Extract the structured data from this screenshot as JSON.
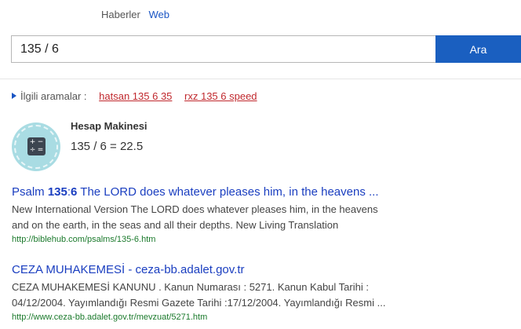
{
  "tabs": {
    "news": "Haberler",
    "web": "Web"
  },
  "search": {
    "query": "135 / 6",
    "button": "Ara"
  },
  "related": {
    "label": "İlgili aramalar :",
    "items": [
      "hatsan 135 6 35",
      "rxz 135 6 speed"
    ]
  },
  "calculator": {
    "title": "Hesap Makinesi",
    "result": "135 / 6 = 22.5",
    "icon": "calculator-icon",
    "keys": [
      "+",
      "−",
      "÷",
      "="
    ]
  },
  "results": [
    {
      "title_parts": [
        "Psalm ",
        "135",
        ":",
        "6",
        " The LORD does whatever pleases him, in the heavens ..."
      ],
      "snippet_lines": [
        "New International Version The LORD does whatever pleases him, in the heavens",
        "and on the earth, in the seas and all their depths. New Living Translation"
      ],
      "url": "http://biblehub.com/psalms/135-6.htm"
    },
    {
      "title": "CEZA MUHAKEMESİ - ceza-bb.adalet.gov.tr",
      "snippet_lines": [
        "CEZA MUHAKEMESİ KANUNU . Kanun Numarası : 5271. Kanun Kabul Tarihi :",
        "04/12/2004. Yayımlandığı Resmi Gazete Tarihi :17/12/2004. Yayımlandığı Resmi ..."
      ],
      "url": "http://www.ceza-bb.adalet.gov.tr/mevzuat/5271.htm"
    }
  ],
  "colors": {
    "accent": "#1a5fc0",
    "link": "#1a3ec0",
    "related_link": "#c0282d",
    "url": "#1b7a2c",
    "badge": "#a9dce3"
  }
}
